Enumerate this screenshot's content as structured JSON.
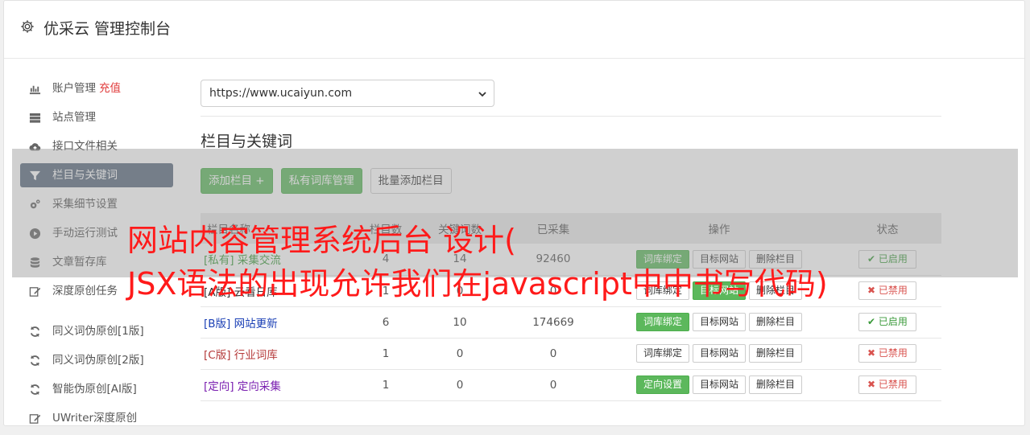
{
  "header": {
    "title": "优采云 管理控制台",
    "icon": "gear-icon"
  },
  "sidebar": {
    "items": [
      {
        "label": "账户管理",
        "extra": "充值",
        "icon": "bar-chart-icon"
      },
      {
        "label": "站点管理",
        "icon": "server-icon"
      },
      {
        "label": "接口文件相关",
        "icon": "cloud-upload-icon"
      },
      {
        "label": "栏目与关键词",
        "icon": "filter-icon",
        "active": true
      },
      {
        "label": "采集细节设置",
        "icon": "gears-icon"
      },
      {
        "label": "手动运行测试",
        "icon": "play-circle-icon"
      },
      {
        "label": "文章暂存库",
        "icon": "database-icon"
      },
      {
        "label": "深度原创任务",
        "icon": "edit-icon"
      },
      {
        "label": "同义词伪原创[1版]",
        "icon": "refresh-icon"
      },
      {
        "label": "同义词伪原创[2版]",
        "icon": "refresh-icon"
      },
      {
        "label": "智能伪原创[AI版]",
        "icon": "refresh-icon"
      },
      {
        "label": "UWriter深度原创",
        "icon": "edit-icon"
      }
    ]
  },
  "main": {
    "site_select": {
      "value": "https://www.ucaiyun.com"
    },
    "section_title": "栏目与关键词",
    "buttons": {
      "add_column": "添加栏目 +",
      "private_lib": "私有词库管理",
      "batch_add": "批量添加栏目"
    },
    "table": {
      "headers": [
        "栏目名称",
        "栏目数",
        "关键词数",
        "已采集",
        "操作",
        "状态"
      ],
      "rows": [
        {
          "tag": "[私有]",
          "name": "采集交流",
          "c1": "4",
          "c2": "14",
          "c3": "92460",
          "op1": "词库绑定",
          "op1_green": true,
          "op2": "目标网站",
          "op2_green": false,
          "op3": "删除栏目",
          "status": "已启用",
          "on": true,
          "color": "#3a9a3a"
        },
        {
          "tag": "[A版]",
          "name": "云看日库",
          "c1": "1",
          "c2": "0",
          "c3": "0",
          "op1": "词库绑定",
          "op1_green": false,
          "op2": "目标网站",
          "op2_green": true,
          "op3": "删除栏目",
          "status": "已禁用",
          "on": false,
          "color": "#333333"
        },
        {
          "tag": "[B版]",
          "name": "网站更新",
          "c1": "6",
          "c2": "10",
          "c3": "174669",
          "op1": "词库绑定",
          "op1_green": true,
          "op2": "目标网站",
          "op2_green": false,
          "op3": "删除栏目",
          "status": "已启用",
          "on": true,
          "color": "#1a3fb5"
        },
        {
          "tag": "[C版]",
          "name": "行业词库",
          "c1": "1",
          "c2": "0",
          "c3": "0",
          "op1": "词库绑定",
          "op1_green": false,
          "op2": "目标网站",
          "op2_green": false,
          "op3": "删除栏目",
          "status": "已禁用",
          "on": false,
          "color": "#b53a3a"
        },
        {
          "tag": "[定向]",
          "name": "定向采集",
          "c1": "1",
          "c2": "0",
          "c3": "0",
          "op1": "定向设置",
          "op1_green": true,
          "op2": "目标网站",
          "op2_green": false,
          "op3": "删除栏目",
          "status": "已禁用",
          "on": false,
          "color": "#7a1fb0"
        }
      ]
    }
  },
  "overlay": {
    "line1": "网站内容管理系统后台 设计(",
    "line2": "JSX语法的出现允许我们在javascript中中书写代码)"
  }
}
